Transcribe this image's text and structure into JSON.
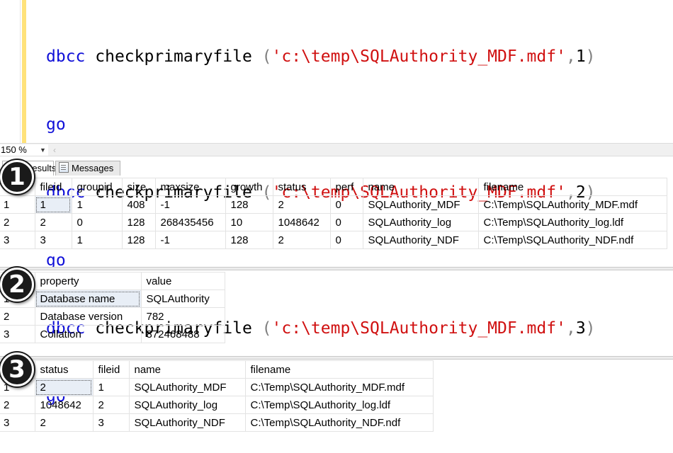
{
  "editor": {
    "lines": [
      {
        "kw": "dbcc",
        "fn": "checkprimaryfile",
        "open": "(",
        "str": "'c:\\temp\\SQLAuthority_MDF.mdf'",
        "comma": ",",
        "arg": "1",
        "close": ")"
      },
      {
        "kw": "go"
      },
      {
        "kw": "dbcc",
        "fn": "checkprimaryfile",
        "open": "(",
        "str": "'c:\\temp\\SQLAuthority_MDF.mdf'",
        "comma": ",",
        "arg": "2",
        "close": ")"
      },
      {
        "kw": "go"
      },
      {
        "kw": "dbcc",
        "fn": "checkprimaryfile",
        "open": "(",
        "str": "'c:\\temp\\SQLAuthority_MDF.mdf'",
        "comma": ",",
        "arg": "3",
        "close": ")"
      },
      {
        "kw": "go"
      }
    ]
  },
  "zoom": {
    "value": "150 %"
  },
  "tabs": {
    "results": "Results",
    "messages": "Messages"
  },
  "badges": [
    "1",
    "2",
    "3"
  ],
  "grid1": {
    "columns": [
      "fileid",
      "groupid",
      "size",
      "maxsize",
      "growth",
      "status",
      "perf",
      "name",
      "filename"
    ],
    "rows": [
      [
        "1",
        "1",
        "1",
        "408",
        "-1",
        "128",
        "2",
        "0",
        "SQLAuthority_MDF",
        "C:\\Temp\\SQLAuthority_MDF.mdf"
      ],
      [
        "2",
        "2",
        "0",
        "128",
        "268435456",
        "10",
        "1048642",
        "0",
        "SQLAuthority_log",
        "C:\\Temp\\SQLAuthority_log.ldf"
      ],
      [
        "3",
        "3",
        "1",
        "128",
        "-1",
        "128",
        "2",
        "0",
        "SQLAuthority_NDF",
        "C:\\Temp\\SQLAuthority_NDF.ndf"
      ]
    ]
  },
  "grid2": {
    "columns": [
      "property",
      "value"
    ],
    "rows": [
      [
        "1",
        "Database name",
        "SQLAuthority"
      ],
      [
        "2",
        "Database version",
        "782"
      ],
      [
        "3",
        "Collation",
        "872468488"
      ]
    ]
  },
  "grid3": {
    "columns": [
      "status",
      "fileid",
      "name",
      "filename"
    ],
    "rows": [
      [
        "1",
        "2",
        "1",
        "SQLAuthority_MDF",
        "C:\\Temp\\SQLAuthority_MDF.mdf"
      ],
      [
        "2",
        "1048642",
        "2",
        "SQLAuthority_log",
        "C:\\Temp\\SQLAuthority_log.ldf"
      ],
      [
        "3",
        "2",
        "3",
        "SQLAuthority_NDF",
        "C:\\Temp\\SQLAuthority_NDF.ndf"
      ]
    ]
  },
  "colors": {
    "keyword": "#1010d8",
    "string": "#d01010",
    "gutter": "#ffe27a",
    "selection": "#e8eef6"
  }
}
